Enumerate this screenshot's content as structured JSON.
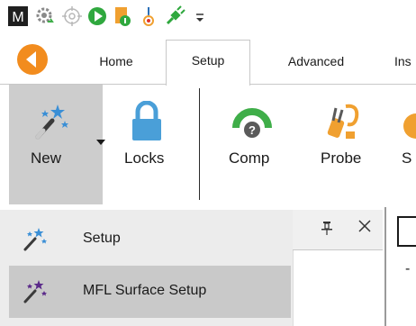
{
  "quick_access": {
    "icons": [
      "app-logo-icon",
      "settings-cycle-icon",
      "target-icon",
      "play-icon",
      "file-info-icon",
      "probe-tip-icon",
      "plug-icon",
      "customize-icon"
    ],
    "app_letter": "M"
  },
  "tabs": [
    {
      "label": "Home",
      "active": false
    },
    {
      "label": "Setup",
      "active": true
    },
    {
      "label": "Advanced",
      "active": false
    },
    {
      "label": "Ins",
      "active": false
    }
  ],
  "ribbon": {
    "new_label": "New",
    "locks_label": "Locks",
    "comp_label": "Comp",
    "probe_label": "Probe",
    "cut_label": "S"
  },
  "menu": {
    "items": [
      {
        "label": "Setup",
        "hover": false
      },
      {
        "label": "MFL Surface Setup",
        "hover": true
      }
    ]
  },
  "panel": {
    "pin_glyph": "ᵽ",
    "close_glyph": "✕",
    "dash": "-"
  },
  "colors": {
    "back_button": "#f28c1e",
    "wand_blue": "#3a8fd6",
    "wand_purple": "#5b2a8a",
    "lock_blue": "#4a9fd8",
    "comp_green": "#3fae49",
    "probe_orange": "#f0a030"
  }
}
